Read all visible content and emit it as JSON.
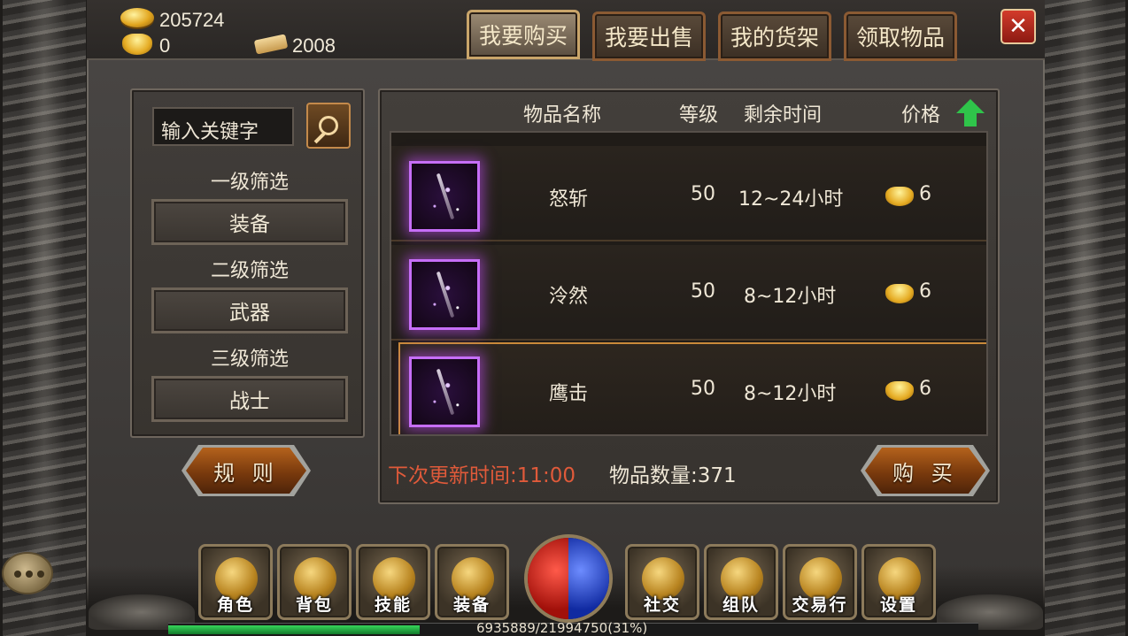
{
  "currency": {
    "coins": "205724",
    "gold_ingots": "0",
    "vouchers": "2008"
  },
  "tabs": [
    {
      "label": "我要购买",
      "active": true
    },
    {
      "label": "我要出售",
      "active": false
    },
    {
      "label": "我的货架",
      "active": false
    },
    {
      "label": "领取物品",
      "active": false
    }
  ],
  "close_icon": "close-icon",
  "filters": {
    "search_placeholder": "输入关键字",
    "level1_label": "一级筛选",
    "level1_value": "装备",
    "level2_label": "二级筛选",
    "level2_value": "武器",
    "level3_label": "三级筛选",
    "level3_value": "战士"
  },
  "rules_button": "规 则",
  "list": {
    "headers": {
      "name": "物品名称",
      "level": "等级",
      "time": "剩余时间",
      "price": "价格"
    },
    "sort": "price-ascending",
    "items": [
      {
        "name": "怒斩",
        "level": "50",
        "time": "12~24小时",
        "price": "6",
        "quality_color": "#c66ef7"
      },
      {
        "name": "泠然",
        "level": "50",
        "time": "8~12小时",
        "price": "6",
        "quality_color": "#c66ef7"
      },
      {
        "name": "鹰击",
        "level": "50",
        "time": "8~12小时",
        "price": "6",
        "quality_color": "#c66ef7",
        "selected": true
      }
    ]
  },
  "footer": {
    "refresh_time": "下次更新时间:11:00",
    "item_count": "物品数量:371",
    "buy_button": "购 买"
  },
  "action_bar": [
    {
      "label": "角色",
      "icon": "character-icon"
    },
    {
      "label": "背包",
      "icon": "bag-icon"
    },
    {
      "label": "技能",
      "icon": "skill-book-icon"
    },
    {
      "label": "装备",
      "icon": "equipment-icon"
    },
    {
      "label": "社交",
      "icon": "handshake-icon"
    },
    {
      "label": "组队",
      "icon": "team-flag-icon"
    },
    {
      "label": "交易行",
      "icon": "auction-hammer-icon"
    },
    {
      "label": "设置",
      "icon": "gear-icon"
    }
  ],
  "experience": {
    "text": "6935889/21994750(31%)",
    "fraction": 0.31
  }
}
